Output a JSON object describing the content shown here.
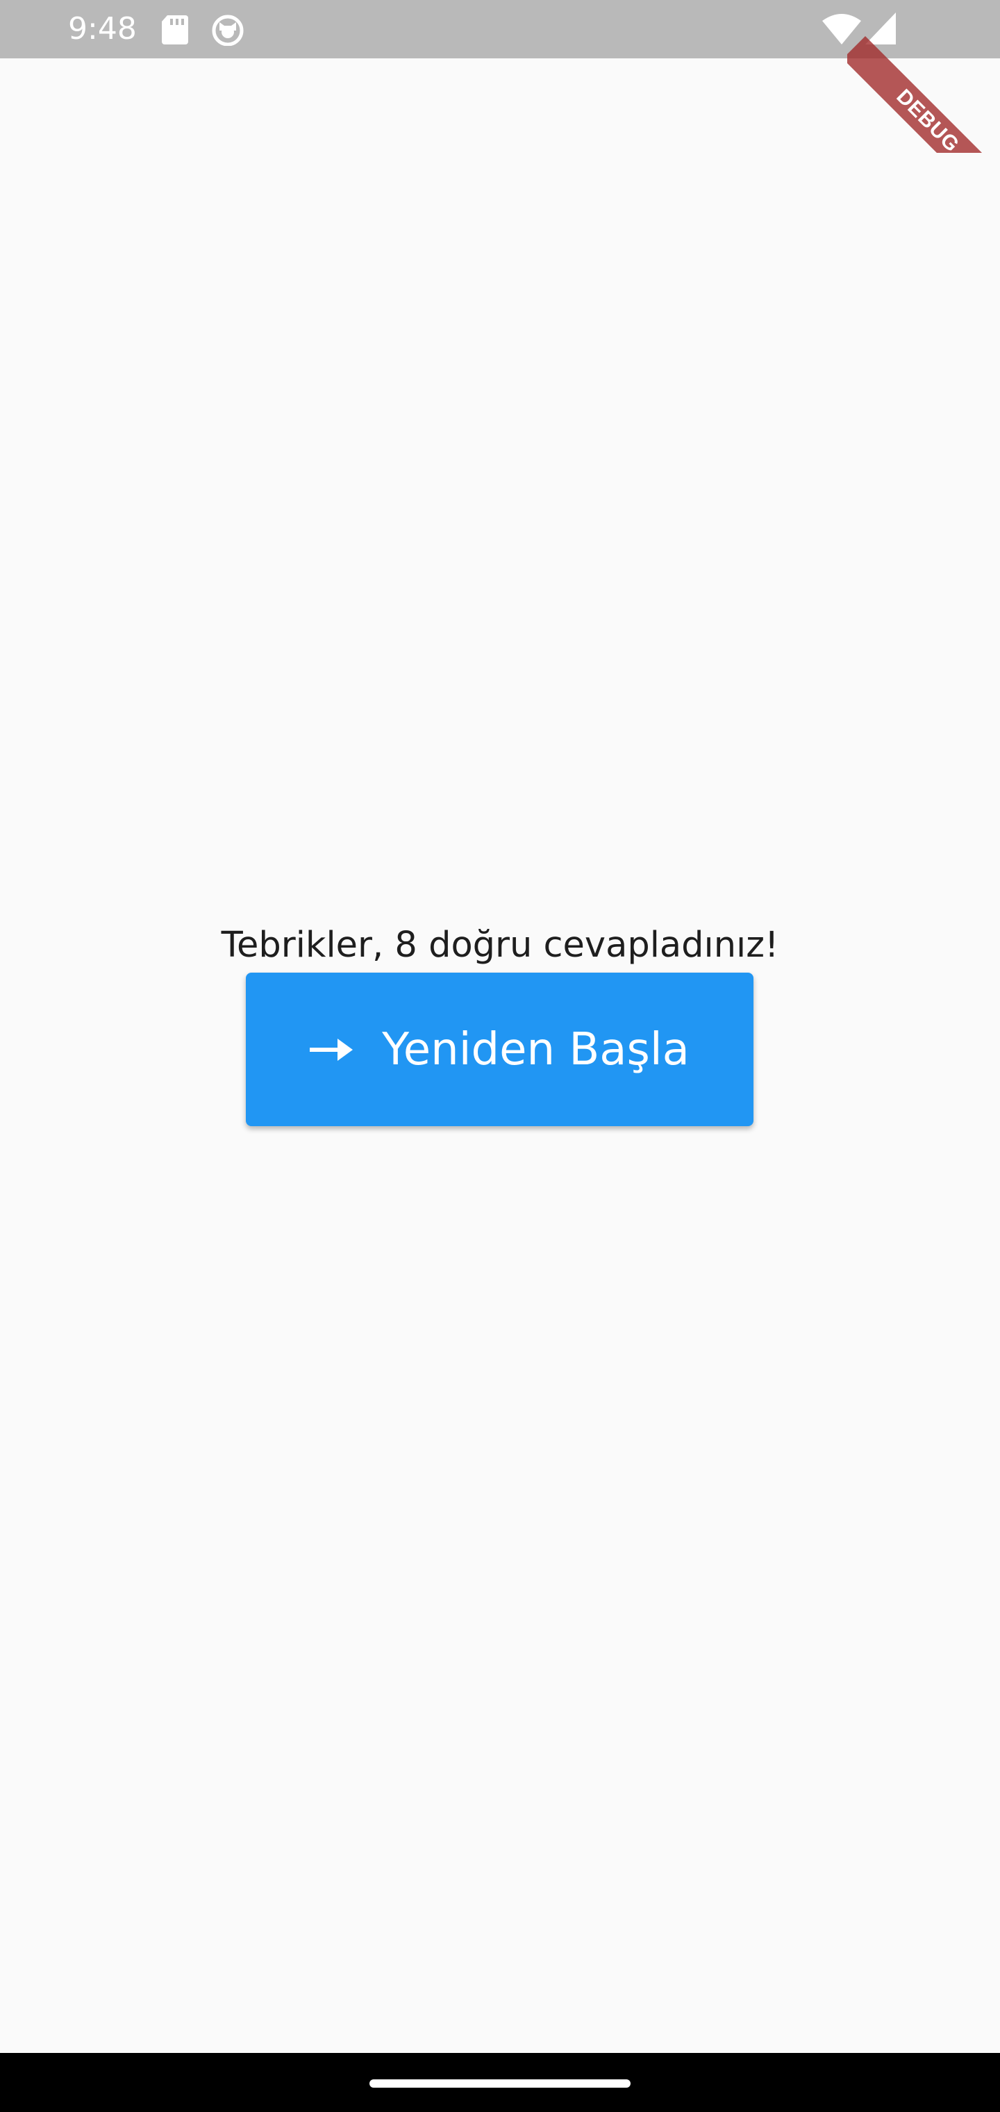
{
  "status_bar": {
    "time": "9:48",
    "icons": [
      "sd-card-icon",
      "cat-icon",
      "wifi-icon",
      "cell-signal-icon"
    ]
  },
  "debug_banner": {
    "label": "DEBUG"
  },
  "result": {
    "message": "Tebrikler, 8 doğru cevapladınız!"
  },
  "restart_button": {
    "label": "Yeniden Başla",
    "icon": "arrow-forward-icon"
  },
  "colors": {
    "background": "#fafafa",
    "status_bar": "#b9b9b9",
    "button": "#2196f3",
    "button_text": "#ffffff",
    "text": "#1e1e1e",
    "nav_bar": "#000000",
    "debug_ribbon": "#a02828"
  }
}
